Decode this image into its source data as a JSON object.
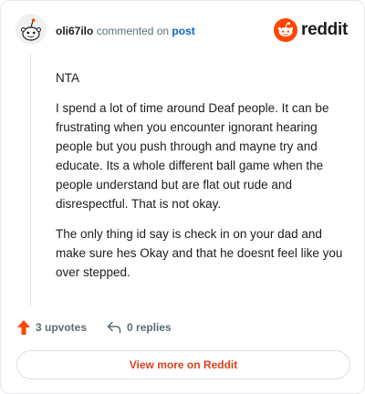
{
  "header": {
    "username": "oli67ilo",
    "action_text": "commented on",
    "post_link": "post",
    "brand": "reddit"
  },
  "comment": {
    "paragraphs": [
      "NTA",
      "I spend a lot of time around Deaf people. It can be frustrating when you encounter ignorant hearing people but you push through and mayne try and educate. Its a whole different ball game when the people understand but are flat out rude and disrespectful. That is not okay.",
      "The only thing id say is check in on your dad and make sure hes Okay and that he doesnt feel like you over stepped."
    ]
  },
  "actions": {
    "upvotes": "3 upvotes",
    "replies": "0 replies"
  },
  "footer": {
    "view_more": "View more on Reddit"
  },
  "colors": {
    "brand_orange": "#ff4500",
    "link_blue": "#0a66c2",
    "view_more_text": "#d9411e"
  },
  "icons": [
    "user-avatar-icon",
    "reddit-logo-icon",
    "upvote-arrow-icon",
    "reply-arrow-icon"
  ]
}
